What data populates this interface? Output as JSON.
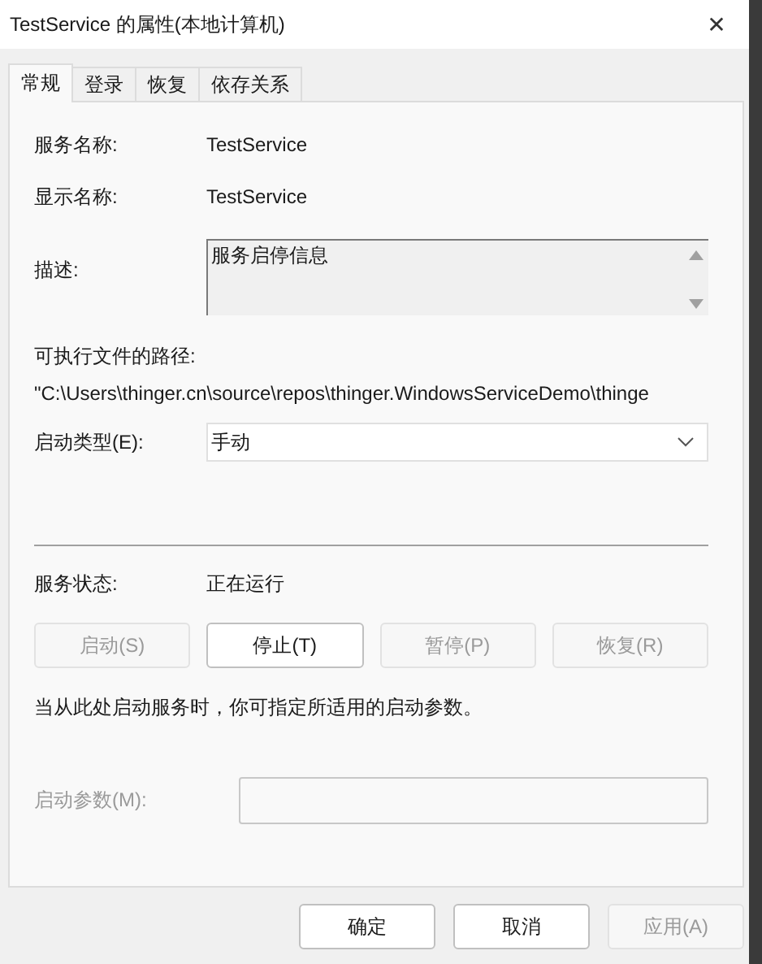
{
  "window": {
    "title": "TestService 的属性(本地计算机)",
    "close": "✕"
  },
  "tabs": [
    {
      "label": "常规",
      "selected": true
    },
    {
      "label": "登录",
      "selected": false
    },
    {
      "label": "恢复",
      "selected": false
    },
    {
      "label": "依存关系",
      "selected": false
    }
  ],
  "fields": [
    {
      "kind": "text",
      "label": "服务名称:",
      "value": "TestService"
    },
    {
      "kind": "text",
      "label": "显示名称:",
      "value": "TestService"
    },
    {
      "kind": "textarea",
      "label": "描述:",
      "value": "服务启停信息"
    }
  ],
  "path": {
    "label": "可执行文件的路径:",
    "value": "\"C:\\Users\\thinger.cn\\source\\repos\\thinger.WindowsServiceDemo\\thinge"
  },
  "startup_type": {
    "label": "启动类型(E):",
    "value": "手动"
  },
  "status": {
    "label": "服务状态:",
    "value": "正在运行"
  },
  "service_buttons": [
    {
      "label": "启动(S)",
      "disabled": true
    },
    {
      "label": "停止(T)",
      "disabled": false
    },
    {
      "label": "暂停(P)",
      "disabled": true
    },
    {
      "label": "恢复(R)",
      "disabled": true
    }
  ],
  "hint": "当从此处启动服务时，你可指定所适用的启动参数。",
  "start_params": {
    "label": "启动参数(M):",
    "disabled": true
  },
  "dialog_buttons": [
    {
      "label": "确定",
      "disabled": false
    },
    {
      "label": "取消",
      "disabled": false
    },
    {
      "label": "应用(A)",
      "disabled": true
    }
  ]
}
